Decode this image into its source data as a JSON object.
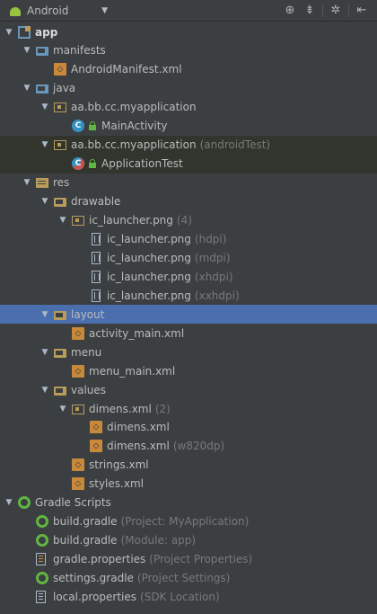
{
  "toolbar": {
    "title": "Android",
    "buttons": [
      {
        "name": "scroll-from-source-icon",
        "glyph": "⊕"
      },
      {
        "name": "collapse-all-icon",
        "glyph": "⇟"
      },
      {
        "name": "settings-gear-icon",
        "glyph": "✲"
      },
      {
        "name": "hide-panel-icon",
        "glyph": "⇤"
      }
    ]
  },
  "tree": [
    {
      "label": "app",
      "depth": 0,
      "arrow": "down",
      "icon": "module",
      "bold": true
    },
    {
      "label": "manifests",
      "depth": 1,
      "arrow": "down",
      "icon": "folder-blue"
    },
    {
      "label": "AndroidManifest.xml",
      "depth": 2,
      "icon": "xml"
    },
    {
      "label": "java",
      "depth": 1,
      "arrow": "down",
      "icon": "folder-blue"
    },
    {
      "label": "aa.bb.cc.myapplication",
      "depth": 2,
      "arrow": "down",
      "icon": "pkg"
    },
    {
      "label": "MainActivity",
      "depth": 3,
      "icon": "class",
      "lock": true
    },
    {
      "label": "aa.bb.cc.myapplication",
      "hint": "(androidTest)",
      "depth": 2,
      "arrow": "down",
      "icon": "pkg",
      "highlight": true
    },
    {
      "label": "ApplicationTest",
      "depth": 3,
      "icon": "class-test",
      "lock": true,
      "highlight": true
    },
    {
      "label": "res",
      "depth": 1,
      "arrow": "down",
      "icon": "resfolder"
    },
    {
      "label": "drawable",
      "depth": 2,
      "arrow": "down",
      "icon": "folder"
    },
    {
      "label": "ic_launcher.png",
      "hint": "(4)",
      "depth": 3,
      "arrow": "down",
      "icon": "pkg"
    },
    {
      "label": "ic_launcher.png",
      "hint": "(hdpi)",
      "depth": 4,
      "icon": "png"
    },
    {
      "label": "ic_launcher.png",
      "hint": "(mdpi)",
      "depth": 4,
      "icon": "png"
    },
    {
      "label": "ic_launcher.png",
      "hint": "(xhdpi)",
      "depth": 4,
      "icon": "png"
    },
    {
      "label": "ic_launcher.png",
      "hint": "(xxhdpi)",
      "depth": 4,
      "icon": "png"
    },
    {
      "label": "layout",
      "depth": 2,
      "arrow": "down",
      "icon": "folder",
      "selected": true
    },
    {
      "label": "activity_main.xml",
      "depth": 3,
      "icon": "xml"
    },
    {
      "label": "menu",
      "depth": 2,
      "arrow": "down",
      "icon": "folder"
    },
    {
      "label": "menu_main.xml",
      "depth": 3,
      "icon": "xml"
    },
    {
      "label": "values",
      "depth": 2,
      "arrow": "down",
      "icon": "folder"
    },
    {
      "label": "dimens.xml",
      "hint": "(2)",
      "depth": 3,
      "arrow": "down",
      "icon": "pkg"
    },
    {
      "label": "dimens.xml",
      "depth": 4,
      "icon": "xml"
    },
    {
      "label": "dimens.xml",
      "hint": "(w820dp)",
      "depth": 4,
      "icon": "xml"
    },
    {
      "label": "strings.xml",
      "depth": 3,
      "icon": "xml"
    },
    {
      "label": "styles.xml",
      "depth": 3,
      "icon": "xml"
    },
    {
      "label": "Gradle Scripts",
      "depth": 0,
      "arrow": "down",
      "icon": "gradle-folder"
    },
    {
      "label": "build.gradle",
      "hint": "(Project: MyApplication)",
      "depth": 1,
      "icon": "gradle"
    },
    {
      "label": "build.gradle",
      "hint": "(Module: app)",
      "depth": 1,
      "icon": "gradle"
    },
    {
      "label": "gradle.properties",
      "hint": "(Project Properties)",
      "depth": 1,
      "icon": "props-or"
    },
    {
      "label": "settings.gradle",
      "hint": "(Project Settings)",
      "depth": 1,
      "icon": "gradle"
    },
    {
      "label": "local.properties",
      "hint": "(SDK Location)",
      "depth": 1,
      "icon": "props"
    }
  ]
}
